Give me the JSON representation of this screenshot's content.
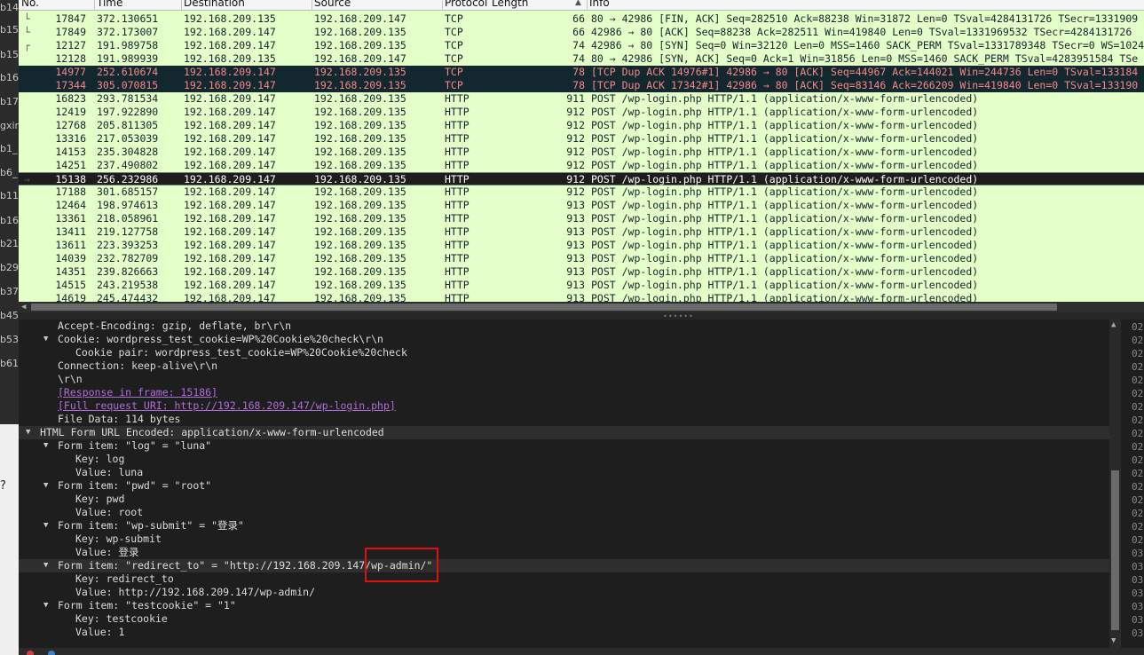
{
  "left_strip": [
    "b14",
    "b15",
    "b15",
    "b16",
    "b17",
    "gxir",
    "b1_",
    "b6_",
    "b11",
    "b16",
    "b21",
    "b29",
    "b37",
    "b45",
    "b53",
    "b61"
  ],
  "left_strip_glyph": "?",
  "columns": {
    "no": "No.",
    "time": "Time",
    "destination": "Destination",
    "source": "Source",
    "protocol": "Protocol",
    "length": "Length",
    "info": "Info"
  },
  "packets": [
    {
      "no": "17847",
      "time": "372.130651",
      "dst": "192.168.209.135",
      "src": "192.168.209.147",
      "proto": "TCP",
      "len": "66",
      "info": "80 → 42986 [FIN, ACK] Seq=282510 Ack=88238 Win=31872 Len=0 TSval=4284131726 TSecr=1331909",
      "state": "normal",
      "mark": "└"
    },
    {
      "no": "17849",
      "time": "372.173007",
      "dst": "192.168.209.147",
      "src": "192.168.209.135",
      "proto": "TCP",
      "len": "66",
      "info": "42986 → 80 [ACK] Seq=88238 Ack=282511 Win=419840 Len=0 TSval=1331969532 TSecr=4284131726",
      "state": "normal",
      "mark": "└"
    },
    {
      "no": "12127",
      "time": "191.989758",
      "dst": "192.168.209.147",
      "src": "192.168.209.135",
      "proto": "TCP",
      "len": "74",
      "info": "42986 → 80 [SYN] Seq=0 Win=32120 Len=0 MSS=1460 SACK_PERM TSval=1331789348 TSecr=0 WS=1024",
      "state": "normal",
      "mark": "┌"
    },
    {
      "no": "12128",
      "time": "191.989939",
      "dst": "192.168.209.135",
      "src": "192.168.209.147",
      "proto": "TCP",
      "len": "74",
      "info": "80 → 42986 [SYN, ACK] Seq=0 Ack=1 Win=31856 Len=0 MSS=1460 SACK_PERM TSval=4283951584 TSe",
      "state": "normal",
      "mark": ""
    },
    {
      "no": "14977",
      "time": "252.610674",
      "dst": "192.168.209.147",
      "src": "192.168.209.135",
      "proto": "TCP",
      "len": "78",
      "info": "[TCP Dup ACK 14976#1] 42986 → 80 [ACK] Seq=44967 Ack=144021 Win=244736 Len=0 TSval=133184",
      "state": "bad",
      "mark": ""
    },
    {
      "no": "17344",
      "time": "305.070815",
      "dst": "192.168.209.147",
      "src": "192.168.209.135",
      "proto": "TCP",
      "len": "78",
      "info": "[TCP Dup ACK 17342#1] 42986 → 80 [ACK] Seq=83146 Ack=266209 Win=419840 Len=0 TSval=133190",
      "state": "bad",
      "mark": ""
    },
    {
      "no": "16823",
      "time": "293.781534",
      "dst": "192.168.209.147",
      "src": "192.168.209.135",
      "proto": "HTTP",
      "len": "911",
      "info": "POST /wp-login.php HTTP/1.1  (application/x-www-form-urlencoded)",
      "state": "normal",
      "mark": ""
    },
    {
      "no": "12419",
      "time": "197.922890",
      "dst": "192.168.209.147",
      "src": "192.168.209.135",
      "proto": "HTTP",
      "len": "912",
      "info": "POST /wp-login.php HTTP/1.1  (application/x-www-form-urlencoded)",
      "state": "normal",
      "mark": ""
    },
    {
      "no": "12768",
      "time": "205.811305",
      "dst": "192.168.209.147",
      "src": "192.168.209.135",
      "proto": "HTTP",
      "len": "912",
      "info": "POST /wp-login.php HTTP/1.1  (application/x-www-form-urlencoded)",
      "state": "normal",
      "mark": ""
    },
    {
      "no": "13316",
      "time": "217.053039",
      "dst": "192.168.209.147",
      "src": "192.168.209.135",
      "proto": "HTTP",
      "len": "912",
      "info": "POST /wp-login.php HTTP/1.1  (application/x-www-form-urlencoded)",
      "state": "normal",
      "mark": ""
    },
    {
      "no": "14153",
      "time": "235.304828",
      "dst": "192.168.209.147",
      "src": "192.168.209.135",
      "proto": "HTTP",
      "len": "912",
      "info": "POST /wp-login.php HTTP/1.1  (application/x-www-form-urlencoded)",
      "state": "normal",
      "mark": ""
    },
    {
      "no": "14251",
      "time": "237.490802",
      "dst": "192.168.209.147",
      "src": "192.168.209.135",
      "proto": "HTTP",
      "len": "912",
      "info": "POST /wp-login.php HTTP/1.1  (application/x-www-form-urlencoded)",
      "state": "normal",
      "mark": ""
    },
    {
      "no": "15138",
      "time": "256.232986",
      "dst": "192.168.209.147",
      "src": "192.168.209.135",
      "proto": "HTTP",
      "len": "912",
      "info": "POST /wp-login.php HTTP/1.1  (application/x-www-form-urlencoded)",
      "state": "selected",
      "mark": "→"
    },
    {
      "no": "17188",
      "time": "301.685157",
      "dst": "192.168.209.147",
      "src": "192.168.209.135",
      "proto": "HTTP",
      "len": "912",
      "info": "POST /wp-login.php HTTP/1.1  (application/x-www-form-urlencoded)",
      "state": "normal",
      "mark": ""
    },
    {
      "no": "12464",
      "time": "198.974613",
      "dst": "192.168.209.147",
      "src": "192.168.209.135",
      "proto": "HTTP",
      "len": "913",
      "info": "POST /wp-login.php HTTP/1.1  (application/x-www-form-urlencoded)",
      "state": "normal",
      "mark": ""
    },
    {
      "no": "13361",
      "time": "218.058961",
      "dst": "192.168.209.147",
      "src": "192.168.209.135",
      "proto": "HTTP",
      "len": "913",
      "info": "POST /wp-login.php HTTP/1.1  (application/x-www-form-urlencoded)",
      "state": "normal",
      "mark": ""
    },
    {
      "no": "13411",
      "time": "219.127758",
      "dst": "192.168.209.147",
      "src": "192.168.209.135",
      "proto": "HTTP",
      "len": "913",
      "info": "POST /wp-login.php HTTP/1.1  (application/x-www-form-urlencoded)",
      "state": "normal",
      "mark": ""
    },
    {
      "no": "13611",
      "time": "223.393253",
      "dst": "192.168.209.147",
      "src": "192.168.209.135",
      "proto": "HTTP",
      "len": "913",
      "info": "POST /wp-login.php HTTP/1.1  (application/x-www-form-urlencoded)",
      "state": "normal",
      "mark": ""
    },
    {
      "no": "14039",
      "time": "232.782709",
      "dst": "192.168.209.147",
      "src": "192.168.209.135",
      "proto": "HTTP",
      "len": "913",
      "info": "POST /wp-login.php HTTP/1.1  (application/x-www-form-urlencoded)",
      "state": "normal",
      "mark": ""
    },
    {
      "no": "14351",
      "time": "239.826663",
      "dst": "192.168.209.147",
      "src": "192.168.209.135",
      "proto": "HTTP",
      "len": "913",
      "info": "POST /wp-login.php HTTP/1.1  (application/x-www-form-urlencoded)",
      "state": "normal",
      "mark": ""
    },
    {
      "no": "14515",
      "time": "243.219538",
      "dst": "192.168.209.147",
      "src": "192.168.209.135",
      "proto": "HTTP",
      "len": "913",
      "info": "POST /wp-login.php HTTP/1.1  (application/x-www-form-urlencoded)",
      "state": "normal",
      "mark": ""
    },
    {
      "no": "14619",
      "time": "245.474432",
      "dst": "192.168.209.147",
      "src": "192.168.209.135",
      "proto": "HTTP",
      "len": "913",
      "info": "POST /wp-login.php HTTP/1.1  (application/x-www-form-urlencoded)",
      "state": "normal",
      "mark": ""
    }
  ],
  "detail_tree": [
    {
      "indent": 2,
      "twisty": "",
      "text": "Accept-Encoding: gzip, deflate, br\\r\\n"
    },
    {
      "indent": 2,
      "twisty": "▼",
      "text": "Cookie: wordpress_test_cookie=WP%20Cookie%20check\\r\\n"
    },
    {
      "indent": 3,
      "twisty": "",
      "text": "Cookie pair: wordpress_test_cookie=WP%20Cookie%20check"
    },
    {
      "indent": 2,
      "twisty": "",
      "text": "Connection: keep-alive\\r\\n"
    },
    {
      "indent": 2,
      "twisty": "",
      "text": "\\r\\n"
    },
    {
      "indent": 2,
      "twisty": "",
      "text": "[Response in frame: 15186]",
      "link": true
    },
    {
      "indent": 2,
      "twisty": "",
      "text": "[Full request URI: http://192.168.209.147/wp-login.php]",
      "link": true
    },
    {
      "indent": 2,
      "twisty": "",
      "text": "File Data: 114 bytes"
    },
    {
      "indent": 1,
      "twisty": "▼",
      "text": "HTML Form URL Encoded: application/x-www-form-urlencoded",
      "hl": true
    },
    {
      "indent": 2,
      "twisty": "▼",
      "text": "Form item: \"log\" = \"luna\""
    },
    {
      "indent": 3,
      "twisty": "",
      "text": "Key: log"
    },
    {
      "indent": 3,
      "twisty": "",
      "text": "Value: luna"
    },
    {
      "indent": 2,
      "twisty": "▼",
      "text": "Form item: \"pwd\" = \"root\""
    },
    {
      "indent": 3,
      "twisty": "",
      "text": "Key: pwd"
    },
    {
      "indent": 3,
      "twisty": "",
      "text": "Value: root"
    },
    {
      "indent": 2,
      "twisty": "▼",
      "text": "Form item: \"wp-submit\" = \"登录\""
    },
    {
      "indent": 3,
      "twisty": "",
      "text": "Key: wp-submit"
    },
    {
      "indent": 3,
      "twisty": "",
      "text": "Value: 登录"
    },
    {
      "indent": 2,
      "twisty": "▼",
      "text": "Form item: \"redirect_to\" = \"http://192.168.209.147/wp-admin/\"",
      "hl": true
    },
    {
      "indent": 3,
      "twisty": "",
      "text": "Key: redirect_to"
    },
    {
      "indent": 3,
      "twisty": "",
      "text": "Value: http://192.168.209.147/wp-admin/"
    },
    {
      "indent": 2,
      "twisty": "▼",
      "text": "Form item: \"testcookie\" = \"1\""
    },
    {
      "indent": 3,
      "twisty": "",
      "text": "Key: testcookie"
    },
    {
      "indent": 3,
      "twisty": "",
      "text": "Value: 1"
    }
  ],
  "bytes_offsets": [
    "02",
    "02",
    "02",
    "02",
    "02",
    "02",
    "02",
    "02",
    "02",
    "02",
    "02",
    "02",
    "02",
    "02",
    "02",
    "02",
    "02",
    "03",
    "03",
    "03",
    "03",
    "03",
    "03",
    "03"
  ],
  "colors": {
    "tcp_bg": "#e4ffc7",
    "bad_bg": "#12272e",
    "bad_fg": "#f78787",
    "selected_bg": "#1d1d1d",
    "highlight_box": "#e01010",
    "link": "#b06ed8"
  }
}
